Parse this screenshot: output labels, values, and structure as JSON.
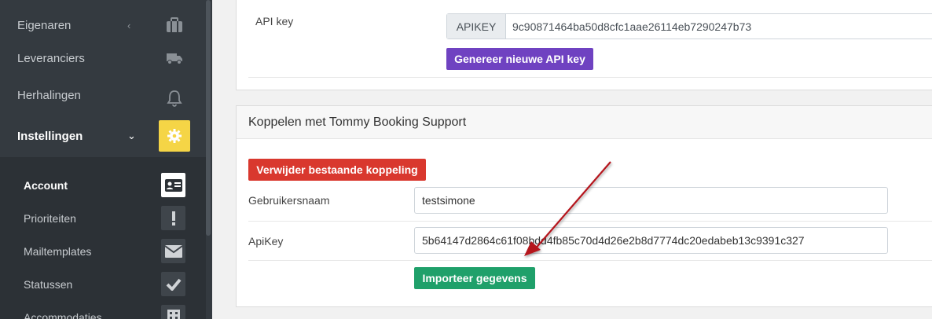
{
  "sidebar": {
    "items": [
      {
        "label": "Eigenaren",
        "icon": "briefcase-icon",
        "chevron": "‹"
      },
      {
        "label": "Leveranciers",
        "icon": "truck-icon"
      },
      {
        "label": "Herhalingen",
        "icon": "bell-icon"
      },
      {
        "label": "Instellingen",
        "icon": "gear-icon",
        "chevron": "⌄"
      }
    ],
    "subitems": [
      {
        "label": "Account",
        "icon": "id-card-icon"
      },
      {
        "label": "Prioriteiten",
        "icon": "exclamation-icon"
      },
      {
        "label": "Mailtemplates",
        "icon": "envelope-icon"
      },
      {
        "label": "Statussen",
        "icon": "check-icon"
      },
      {
        "label": "Accommodaties",
        "icon": "building-icon"
      }
    ]
  },
  "api_card": {
    "label": "API key",
    "addon": "APIKEY",
    "value": "9c90871464ba50d8cfc1aae26114eb7290247b73",
    "generate_button": "Genereer nieuwe API key"
  },
  "tommy_card": {
    "title": "Koppelen met Tommy Booking Support",
    "delete_button": "Verwijder bestaande koppeling",
    "username_label": "Gebruikersnaam",
    "username_value": "testsimone",
    "apikey_label": "ApiKey",
    "apikey_value": "5b64147d2864c61f08bdd4fb85c70d4d26e2b8d7774dc20edabeb13c9391c327",
    "import_button": "Importeer gegevens"
  },
  "colors": {
    "sidebar": "#343a40",
    "accent_yellow": "#f5d546",
    "purple": "#6f42c1",
    "red": "#d9382e",
    "green": "#1fa06a",
    "arrow": "#b5121b"
  }
}
